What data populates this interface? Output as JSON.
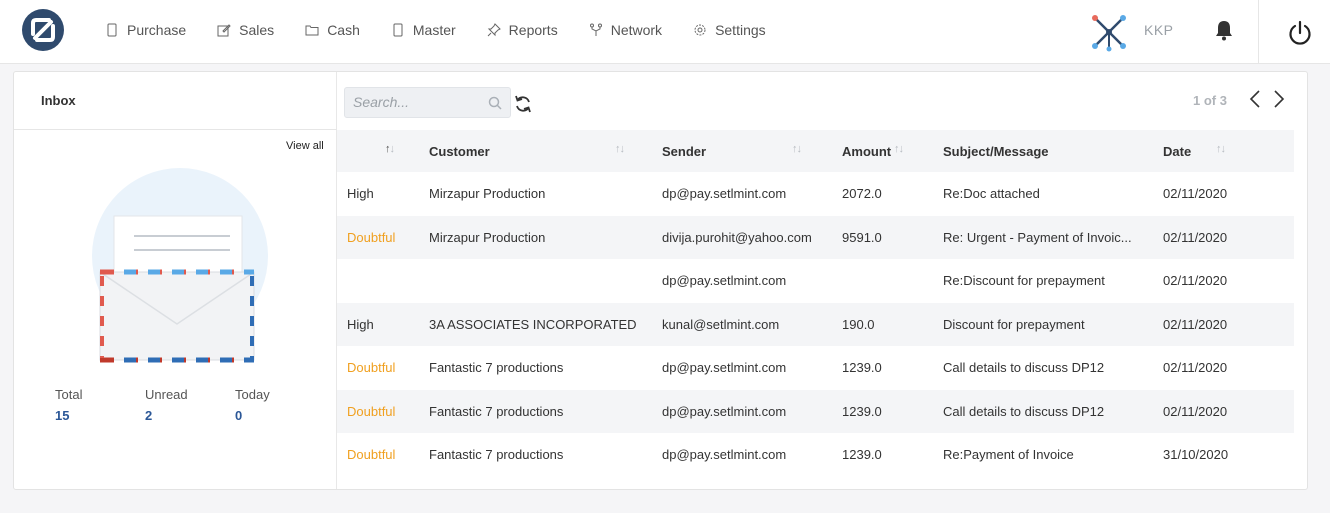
{
  "nav": {
    "items": [
      {
        "label": "Purchase",
        "icon": "mobile-icon"
      },
      {
        "label": "Sales",
        "icon": "edit-icon"
      },
      {
        "label": "Cash",
        "icon": "folder-icon"
      },
      {
        "label": "Master",
        "icon": "mobile-icon"
      },
      {
        "label": "Reports",
        "icon": "pin-icon"
      },
      {
        "label": "Network",
        "icon": "fork-icon"
      },
      {
        "label": "Settings",
        "icon": "gear-icon"
      }
    ],
    "user": "KKP"
  },
  "inbox": {
    "title": "Inbox",
    "view_all": "View all",
    "stats": [
      {
        "label": "Total",
        "value": "15"
      },
      {
        "label": "Unread",
        "value": "2"
      },
      {
        "label": "Today",
        "value": "0"
      }
    ]
  },
  "toolbar": {
    "search_placeholder": "Search...",
    "pager": "1 of 3"
  },
  "table": {
    "headers": [
      "",
      "Customer",
      "Sender",
      "Amount",
      "Subject/Message",
      "Date"
    ],
    "rows": [
      {
        "priority": "High",
        "customer": "Mirzapur Production",
        "sender": "dp@pay.setlmint.com",
        "amount": "2072.0",
        "subject": "Re:Doc attached",
        "date": "02/11/2020"
      },
      {
        "priority": "Doubtful",
        "customer": "Mirzapur Production",
        "sender": "divija.purohit@yahoo.com",
        "amount": "9591.0",
        "subject": "Re: Urgent - Payment of Invoic...",
        "date": "02/11/2020"
      },
      {
        "priority": "",
        "customer": "",
        "sender": "dp@pay.setlmint.com",
        "amount": "",
        "subject": "Re:Discount for prepayment",
        "date": "02/11/2020"
      },
      {
        "priority": "High",
        "customer": "3A ASSOCIATES INCORPORATED",
        "sender": "kunal@setlmint.com",
        "amount": "190.0",
        "subject": "Discount for prepayment",
        "date": "02/11/2020"
      },
      {
        "priority": "Doubtful",
        "customer": "Fantastic 7 productions",
        "sender": "dp@pay.setlmint.com",
        "amount": "1239.0",
        "subject": "Call details to discuss DP12",
        "date": "02/11/2020"
      },
      {
        "priority": "Doubtful",
        "customer": "Fantastic 7 productions",
        "sender": "dp@pay.setlmint.com",
        "amount": "1239.0",
        "subject": "Call details to discuss DP12",
        "date": "02/11/2020"
      },
      {
        "priority": "Doubtful",
        "customer": "Fantastic 7 productions",
        "sender": "dp@pay.setlmint.com",
        "amount": "1239.0",
        "subject": "Re:Payment of Invoice",
        "date": "31/10/2020"
      }
    ]
  },
  "colors": {
    "brand": "#2f4a6d",
    "doubtful": "#f0a020",
    "stat_value": "#2b5797"
  }
}
